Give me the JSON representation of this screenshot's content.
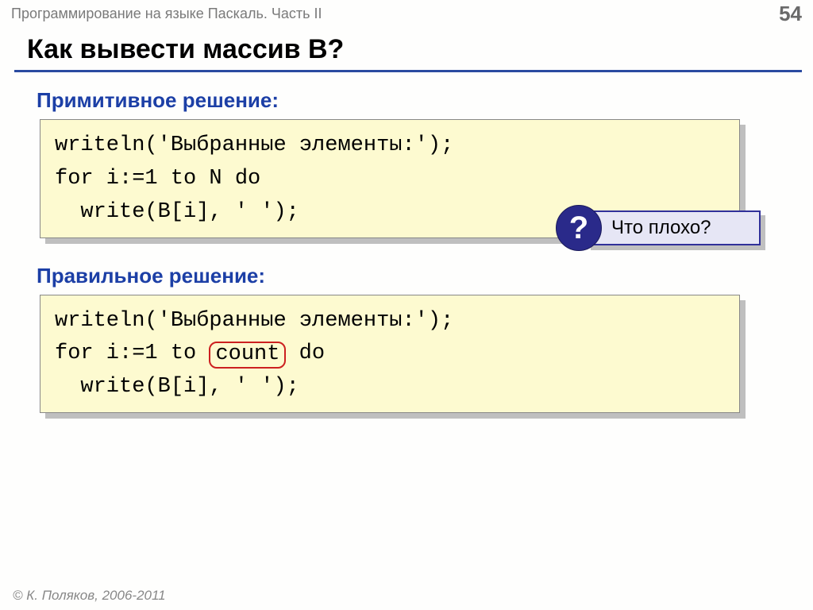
{
  "header": {
    "course": "Программирование на языке Паскаль. Часть II",
    "page": "54"
  },
  "title": "Как вывести массив B?",
  "sections": {
    "primitive": {
      "label": "Примитивное решение:",
      "code_l1": "writeln('Выбранные элементы:');",
      "code_l2": "for i:=1 to N do",
      "code_l3": "  write(B[i], ' ');"
    },
    "correct": {
      "label": "Правильное решение:",
      "code_l1": "writeln('Выбранные элементы:');",
      "code_l2a": "for i:=1 to ",
      "code_l2b": "count",
      "code_l2c": " do",
      "code_l3": "  write(B[i], ' ');"
    }
  },
  "callout": {
    "icon": "?",
    "text": "Что плохо?"
  },
  "footer": "© К. Поляков, 2006-2011"
}
